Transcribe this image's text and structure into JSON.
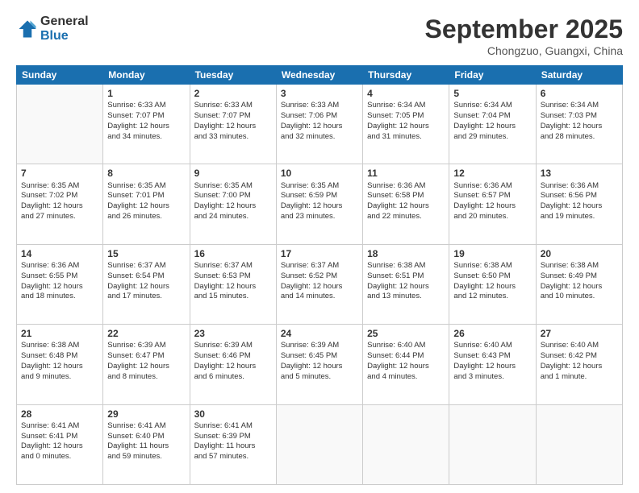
{
  "logo": {
    "general": "General",
    "blue": "Blue"
  },
  "title": "September 2025",
  "location": "Chongzuo, Guangxi, China",
  "headers": [
    "Sunday",
    "Monday",
    "Tuesday",
    "Wednesday",
    "Thursday",
    "Friday",
    "Saturday"
  ],
  "weeks": [
    [
      {
        "day": "",
        "text": ""
      },
      {
        "day": "1",
        "text": "Sunrise: 6:33 AM\nSunset: 7:07 PM\nDaylight: 12 hours\nand 34 minutes."
      },
      {
        "day": "2",
        "text": "Sunrise: 6:33 AM\nSunset: 7:07 PM\nDaylight: 12 hours\nand 33 minutes."
      },
      {
        "day": "3",
        "text": "Sunrise: 6:33 AM\nSunset: 7:06 PM\nDaylight: 12 hours\nand 32 minutes."
      },
      {
        "day": "4",
        "text": "Sunrise: 6:34 AM\nSunset: 7:05 PM\nDaylight: 12 hours\nand 31 minutes."
      },
      {
        "day": "5",
        "text": "Sunrise: 6:34 AM\nSunset: 7:04 PM\nDaylight: 12 hours\nand 29 minutes."
      },
      {
        "day": "6",
        "text": "Sunrise: 6:34 AM\nSunset: 7:03 PM\nDaylight: 12 hours\nand 28 minutes."
      }
    ],
    [
      {
        "day": "7",
        "text": "Sunrise: 6:35 AM\nSunset: 7:02 PM\nDaylight: 12 hours\nand 27 minutes."
      },
      {
        "day": "8",
        "text": "Sunrise: 6:35 AM\nSunset: 7:01 PM\nDaylight: 12 hours\nand 26 minutes."
      },
      {
        "day": "9",
        "text": "Sunrise: 6:35 AM\nSunset: 7:00 PM\nDaylight: 12 hours\nand 24 minutes."
      },
      {
        "day": "10",
        "text": "Sunrise: 6:35 AM\nSunset: 6:59 PM\nDaylight: 12 hours\nand 23 minutes."
      },
      {
        "day": "11",
        "text": "Sunrise: 6:36 AM\nSunset: 6:58 PM\nDaylight: 12 hours\nand 22 minutes."
      },
      {
        "day": "12",
        "text": "Sunrise: 6:36 AM\nSunset: 6:57 PM\nDaylight: 12 hours\nand 20 minutes."
      },
      {
        "day": "13",
        "text": "Sunrise: 6:36 AM\nSunset: 6:56 PM\nDaylight: 12 hours\nand 19 minutes."
      }
    ],
    [
      {
        "day": "14",
        "text": "Sunrise: 6:36 AM\nSunset: 6:55 PM\nDaylight: 12 hours\nand 18 minutes."
      },
      {
        "day": "15",
        "text": "Sunrise: 6:37 AM\nSunset: 6:54 PM\nDaylight: 12 hours\nand 17 minutes."
      },
      {
        "day": "16",
        "text": "Sunrise: 6:37 AM\nSunset: 6:53 PM\nDaylight: 12 hours\nand 15 minutes."
      },
      {
        "day": "17",
        "text": "Sunrise: 6:37 AM\nSunset: 6:52 PM\nDaylight: 12 hours\nand 14 minutes."
      },
      {
        "day": "18",
        "text": "Sunrise: 6:38 AM\nSunset: 6:51 PM\nDaylight: 12 hours\nand 13 minutes."
      },
      {
        "day": "19",
        "text": "Sunrise: 6:38 AM\nSunset: 6:50 PM\nDaylight: 12 hours\nand 12 minutes."
      },
      {
        "day": "20",
        "text": "Sunrise: 6:38 AM\nSunset: 6:49 PM\nDaylight: 12 hours\nand 10 minutes."
      }
    ],
    [
      {
        "day": "21",
        "text": "Sunrise: 6:38 AM\nSunset: 6:48 PM\nDaylight: 12 hours\nand 9 minutes."
      },
      {
        "day": "22",
        "text": "Sunrise: 6:39 AM\nSunset: 6:47 PM\nDaylight: 12 hours\nand 8 minutes."
      },
      {
        "day": "23",
        "text": "Sunrise: 6:39 AM\nSunset: 6:46 PM\nDaylight: 12 hours\nand 6 minutes."
      },
      {
        "day": "24",
        "text": "Sunrise: 6:39 AM\nSunset: 6:45 PM\nDaylight: 12 hours\nand 5 minutes."
      },
      {
        "day": "25",
        "text": "Sunrise: 6:40 AM\nSunset: 6:44 PM\nDaylight: 12 hours\nand 4 minutes."
      },
      {
        "day": "26",
        "text": "Sunrise: 6:40 AM\nSunset: 6:43 PM\nDaylight: 12 hours\nand 3 minutes."
      },
      {
        "day": "27",
        "text": "Sunrise: 6:40 AM\nSunset: 6:42 PM\nDaylight: 12 hours\nand 1 minute."
      }
    ],
    [
      {
        "day": "28",
        "text": "Sunrise: 6:41 AM\nSunset: 6:41 PM\nDaylight: 12 hours\nand 0 minutes."
      },
      {
        "day": "29",
        "text": "Sunrise: 6:41 AM\nSunset: 6:40 PM\nDaylight: 11 hours\nand 59 minutes."
      },
      {
        "day": "30",
        "text": "Sunrise: 6:41 AM\nSunset: 6:39 PM\nDaylight: 11 hours\nand 57 minutes."
      },
      {
        "day": "",
        "text": ""
      },
      {
        "day": "",
        "text": ""
      },
      {
        "day": "",
        "text": ""
      },
      {
        "day": "",
        "text": ""
      }
    ]
  ]
}
